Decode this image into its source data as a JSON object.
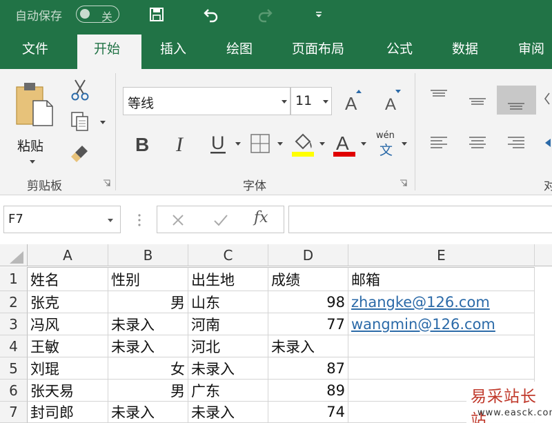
{
  "titlebar": {
    "autosave_label": "自动保存",
    "autosave_state": "关"
  },
  "tabs": [
    "文件",
    "开始",
    "插入",
    "绘图",
    "页面布局",
    "公式",
    "数据",
    "审阅"
  ],
  "ribbon": {
    "paste_label": "粘贴",
    "clipboard_group": "剪贴板",
    "font_group": "字体",
    "font_name": "等线",
    "font_size": "11",
    "phonetic_label": "wén",
    "phonetic_char": "文",
    "align_group_partial": "对",
    "highlight_color": "#ffff00",
    "font_color": "#e00000"
  },
  "formula_bar": {
    "name_box": "F7",
    "fx_label": "fx",
    "formula": ""
  },
  "sheet": {
    "columns": [
      "A",
      "B",
      "C",
      "D",
      "E"
    ],
    "rows": [
      "1",
      "2",
      "3",
      "4",
      "5",
      "6",
      "7"
    ],
    "cells": [
      [
        {
          "v": "姓名"
        },
        {
          "v": "性别"
        },
        {
          "v": "出生地"
        },
        {
          "v": "成绩"
        },
        {
          "v": "邮箱"
        }
      ],
      [
        {
          "v": "张克"
        },
        {
          "v": "男",
          "num": true
        },
        {
          "v": "山东"
        },
        {
          "v": "98",
          "num": true
        },
        {
          "v": "zhangke@126.com",
          "link": true
        }
      ],
      [
        {
          "v": "冯风"
        },
        {
          "v": "未录入"
        },
        {
          "v": "河南"
        },
        {
          "v": "77",
          "num": true
        },
        {
          "v": "wangmin@126.com",
          "link": true
        }
      ],
      [
        {
          "v": "王敏"
        },
        {
          "v": "未录入"
        },
        {
          "v": "河北"
        },
        {
          "v": "未录入"
        },
        {
          "v": ""
        }
      ],
      [
        {
          "v": "刘琨"
        },
        {
          "v": "女",
          "num": true
        },
        {
          "v": "未录入"
        },
        {
          "v": "87",
          "num": true
        },
        {
          "v": ""
        }
      ],
      [
        {
          "v": "张天易"
        },
        {
          "v": "男",
          "num": true
        },
        {
          "v": "广东"
        },
        {
          "v": "89",
          "num": true
        },
        {
          "v": ""
        }
      ],
      [
        {
          "v": "封司郎"
        },
        {
          "v": "未录入"
        },
        {
          "v": "未录入"
        },
        {
          "v": "74",
          "num": true
        },
        {
          "v": ""
        }
      ]
    ]
  },
  "watermark": {
    "text": "易采站长站",
    "url": "www.easck.com"
  }
}
